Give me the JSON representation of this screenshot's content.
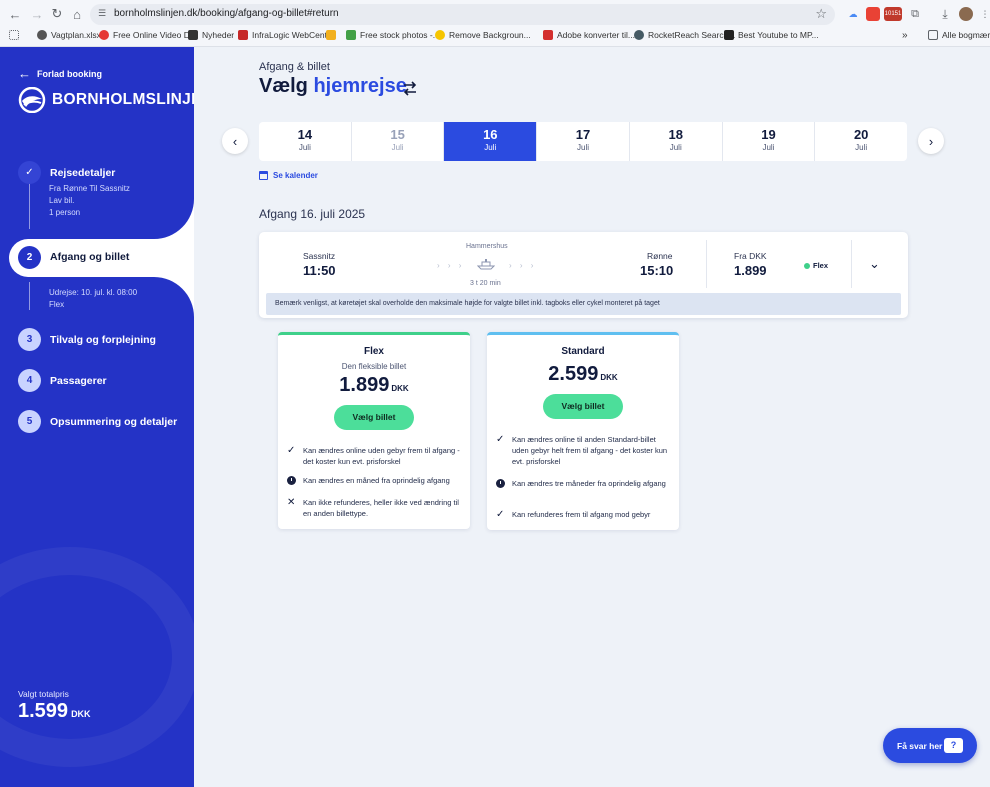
{
  "browser": {
    "url": "bornholmslinjen.dk/booking/afgang-og-billet#return",
    "bookmarks": [
      "Vagtplan.xlsx",
      "Free Online Video D...",
      "Nyheder",
      "InfraLogic WebCenter",
      "",
      "Free stock photos -...",
      "Remove Backgroun...",
      "Adobe konverter til...",
      "RocketReach Search...",
      "Best Youtube to MP..."
    ],
    "more_bookmarks": "Alle bogmærke",
    "ext_badge": "10151"
  },
  "sidebar": {
    "back_label": "Forlad booking",
    "logo_text": "BORNHOLMSLINJEN",
    "steps": [
      {
        "num": "✓",
        "label": "Rejsedetaljer",
        "details": [
          "Fra Rønne Til Sassnitz",
          "Lav bil.",
          "1 person"
        ]
      },
      {
        "num": "2",
        "label": "Afgang og billet",
        "details": [
          "Udrejse: 10. jul. kl. 08:00",
          "Flex"
        ]
      },
      {
        "num": "3",
        "label": "Tilvalg og forplejning"
      },
      {
        "num": "4",
        "label": "Passagerer"
      },
      {
        "num": "5",
        "label": "Opsummering og detaljer"
      }
    ],
    "total_label": "Valgt totalpris",
    "total_value": "1.599",
    "total_currency": "DKK"
  },
  "main": {
    "subtitle": "Afgang & billet",
    "title_prefix": "Vælg",
    "title_highlight": "hjemrejse",
    "dates": [
      {
        "day": "14",
        "month": "Juli",
        "state": "normal"
      },
      {
        "day": "15",
        "month": "Juli",
        "state": "dim"
      },
      {
        "day": "16",
        "month": "Juli",
        "state": "selected"
      },
      {
        "day": "17",
        "month": "Juli",
        "state": "normal"
      },
      {
        "day": "18",
        "month": "Juli",
        "state": "normal"
      },
      {
        "day": "19",
        "month": "Juli",
        "state": "normal"
      },
      {
        "day": "20",
        "month": "Juli",
        "state": "normal"
      }
    ],
    "calendar_link": "Se kalender",
    "departure_heading": "Afgang 16. juli 2025",
    "trip": {
      "from_city": "Sassnitz",
      "from_time": "11:50",
      "ship": "Hammershus",
      "duration": "3 t 20 min",
      "to_city": "Rønne",
      "to_time": "15:10",
      "price_from": "Fra DKK",
      "price": "1.899",
      "fare_tag": "Flex",
      "notice": "Bemærk venligst, at køretøjet skal overholde den maksimale højde for valgte billet inkl. tagboks eller cykel monteret på taget"
    },
    "tickets": [
      {
        "name": "Flex",
        "subtitle": "Den fleksible billet",
        "price": "1.899",
        "currency": "DKK",
        "button": "Vælg billet",
        "features": [
          {
            "icon": "check-icon",
            "text": "Kan ændres online uden gebyr frem til afgang - det koster kun evt. prisforskel"
          },
          {
            "icon": "clock-icon",
            "text": "Kan ændres en måned fra oprindelig afgang"
          },
          {
            "icon": "cross-icon",
            "text": "Kan ikke refunderes, heller ikke ved ændring til en anden billettype."
          }
        ]
      },
      {
        "name": "Standard",
        "subtitle": "",
        "price": "2.599",
        "currency": "DKK",
        "button": "Vælg billet",
        "features": [
          {
            "icon": "check-icon",
            "text": "Kan ændres online til anden Standard-billet uden gebyr helt frem til afgang - det koster kun evt. prisforskel"
          },
          {
            "icon": "clock-icon",
            "text": "Kan ændres tre måneder fra oprindelig afgang"
          },
          {
            "icon": "check-icon",
            "text": "Kan refunderes frem til afgang mod gebyr"
          }
        ]
      }
    ],
    "help_label": "Få svar her",
    "help_icon": "?"
  },
  "colors": {
    "brand": "#2433c6",
    "accent": "#2b4be0",
    "green": "#4cde9a",
    "page_bg": "#eef2f8"
  }
}
